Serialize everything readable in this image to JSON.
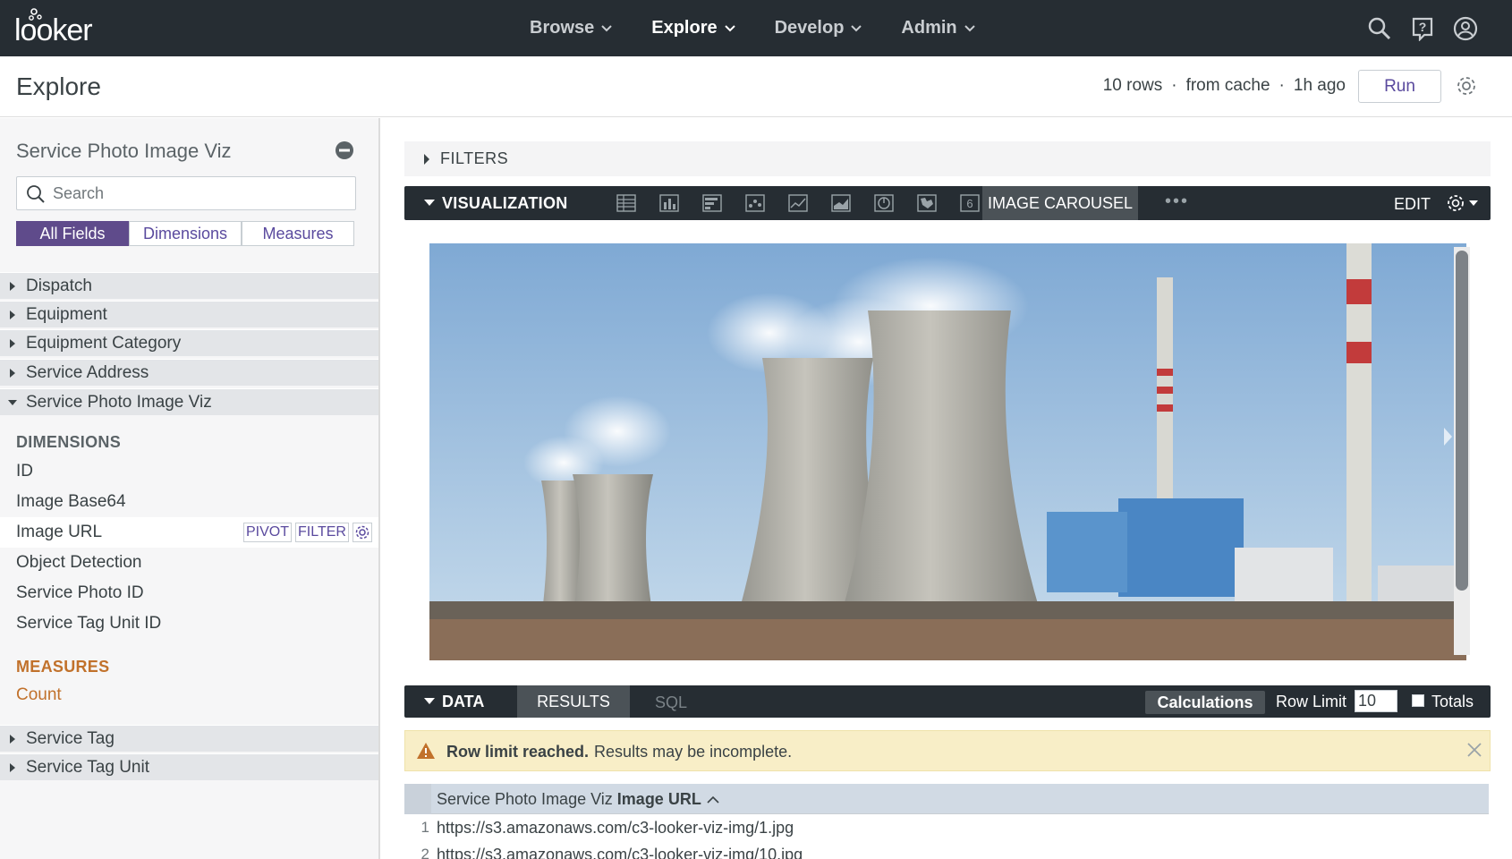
{
  "app": {
    "logo": "looker"
  },
  "nav": {
    "items": [
      {
        "label": "Browse",
        "active": false
      },
      {
        "label": "Explore",
        "active": true
      },
      {
        "label": "Develop",
        "active": false
      },
      {
        "label": "Admin",
        "active": false
      }
    ]
  },
  "header": {
    "title": "Explore",
    "rows": "10 rows",
    "cache": "from cache",
    "age": "1h ago",
    "sep": "·",
    "run_label": "Run"
  },
  "sidebar": {
    "title": "Service Photo Image Viz",
    "search_placeholder": "Search",
    "tabs": [
      {
        "label": "All Fields",
        "active": true
      },
      {
        "label": "Dimensions",
        "active": false
      },
      {
        "label": "Measures",
        "active": false
      }
    ],
    "groups_top": [
      "Dispatch",
      "Equipment",
      "Equipment Category",
      "Service Address"
    ],
    "open_group": "Service Photo Image Viz",
    "dimensions_heading": "DIMENSIONS",
    "dimensions": [
      "ID",
      "Image Base64",
      "Image URL",
      "Object Detection",
      "Service Photo ID",
      "Service Tag Unit ID"
    ],
    "hovered_field_actions": {
      "pivot": "PIVOT",
      "filter": "FILTER"
    },
    "measures_heading": "MEASURES",
    "measures": [
      "Count"
    ],
    "groups_bottom": [
      "Service Tag",
      "Service Tag Unit"
    ]
  },
  "filters": {
    "label": "FILTERS"
  },
  "visualization": {
    "label": "VISUALIZATION",
    "icons": [
      "table-icon",
      "column-icon",
      "bar-icon",
      "scatter-icon",
      "line-icon",
      "area-icon",
      "pie-icon",
      "map-icon",
      "single-value-icon"
    ],
    "single_value_glyph": "6",
    "active_type": "IMAGE CAROUSEL",
    "more": "•••",
    "edit_label": "EDIT"
  },
  "data": {
    "label": "DATA",
    "tab_results": "RESULTS",
    "tab_sql": "SQL",
    "calculations": "Calculations",
    "row_limit_label": "Row Limit",
    "row_limit_value": "10",
    "totals_label": "Totals"
  },
  "warning": {
    "bold": "Row limit reached.",
    "text": "Results may be incomplete."
  },
  "results": {
    "column_view": "Service Photo Image Viz",
    "column_field": "Image URL",
    "rows": [
      {
        "index": "1",
        "value": "https://s3.amazonaws.com/c3-looker-viz-img/1.jpg"
      },
      {
        "index": "2",
        "value": "https://s3.amazonaws.com/c3-looker-viz-img/10.jpg"
      }
    ]
  },
  "colors": {
    "topbar": "#262d33",
    "accent": "#5f4b8b",
    "measure": "#c1712b",
    "warning_bg": "#f8eec7"
  }
}
